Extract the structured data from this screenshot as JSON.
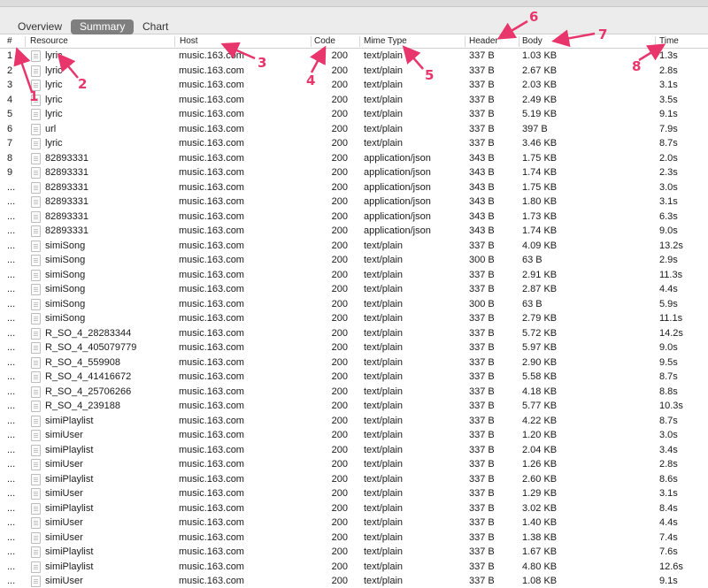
{
  "tabs": {
    "overview": "Overview",
    "summary": "Summary",
    "chart": "Chart"
  },
  "columns": {
    "idx": "#",
    "resource": "Resource",
    "host": "Host",
    "code": "Code",
    "mime": "Mime Type",
    "header": "Header",
    "body": "Body",
    "time": "Time"
  },
  "rows": [
    {
      "i": "1",
      "r": "lyric",
      "h": "music.163.com",
      "c": "200",
      "m": "text/plain",
      "hd": "337 B",
      "b": "1.03 KB",
      "t": "1.3s"
    },
    {
      "i": "2",
      "r": "lyric",
      "h": "music.163.com",
      "c": "200",
      "m": "text/plain",
      "hd": "337 B",
      "b": "2.67 KB",
      "t": "2.8s"
    },
    {
      "i": "3",
      "r": "lyric",
      "h": "music.163.com",
      "c": "200",
      "m": "text/plain",
      "hd": "337 B",
      "b": "2.03 KB",
      "t": "3.1s"
    },
    {
      "i": "4",
      "r": "lyric",
      "h": "music.163.com",
      "c": "200",
      "m": "text/plain",
      "hd": "337 B",
      "b": "2.49 KB",
      "t": "3.5s"
    },
    {
      "i": "5",
      "r": "lyric",
      "h": "music.163.com",
      "c": "200",
      "m": "text/plain",
      "hd": "337 B",
      "b": "5.19 KB",
      "t": "9.1s"
    },
    {
      "i": "6",
      "r": "url",
      "h": "music.163.com",
      "c": "200",
      "m": "text/plain",
      "hd": "337 B",
      "b": "397 B",
      "t": "7.9s"
    },
    {
      "i": "7",
      "r": "lyric",
      "h": "music.163.com",
      "c": "200",
      "m": "text/plain",
      "hd": "337 B",
      "b": "3.46 KB",
      "t": "8.7s"
    },
    {
      "i": "8",
      "r": "82893331",
      "h": "music.163.com",
      "c": "200",
      "m": "application/json",
      "hd": "343 B",
      "b": "1.75 KB",
      "t": "2.0s"
    },
    {
      "i": "9",
      "r": "82893331",
      "h": "music.163.com",
      "c": "200",
      "m": "application/json",
      "hd": "343 B",
      "b": "1.74 KB",
      "t": "2.3s"
    },
    {
      "i": "...",
      "r": "82893331",
      "h": "music.163.com",
      "c": "200",
      "m": "application/json",
      "hd": "343 B",
      "b": "1.75 KB",
      "t": "3.0s"
    },
    {
      "i": "...",
      "r": "82893331",
      "h": "music.163.com",
      "c": "200",
      "m": "application/json",
      "hd": "343 B",
      "b": "1.80 KB",
      "t": "3.1s"
    },
    {
      "i": "...",
      "r": "82893331",
      "h": "music.163.com",
      "c": "200",
      "m": "application/json",
      "hd": "343 B",
      "b": "1.73 KB",
      "t": "6.3s"
    },
    {
      "i": "...",
      "r": "82893331",
      "h": "music.163.com",
      "c": "200",
      "m": "application/json",
      "hd": "343 B",
      "b": "1.74 KB",
      "t": "9.0s"
    },
    {
      "i": "...",
      "r": "simiSong",
      "h": "music.163.com",
      "c": "200",
      "m": "text/plain",
      "hd": "337 B",
      "b": "4.09 KB",
      "t": "13.2s"
    },
    {
      "i": "...",
      "r": "simiSong",
      "h": "music.163.com",
      "c": "200",
      "m": "text/plain",
      "hd": "300 B",
      "b": "63 B",
      "t": "2.9s"
    },
    {
      "i": "...",
      "r": "simiSong",
      "h": "music.163.com",
      "c": "200",
      "m": "text/plain",
      "hd": "337 B",
      "b": "2.91 KB",
      "t": "11.3s"
    },
    {
      "i": "...",
      "r": "simiSong",
      "h": "music.163.com",
      "c": "200",
      "m": "text/plain",
      "hd": "337 B",
      "b": "2.87 KB",
      "t": "4.4s"
    },
    {
      "i": "...",
      "r": "simiSong",
      "h": "music.163.com",
      "c": "200",
      "m": "text/plain",
      "hd": "300 B",
      "b": "63 B",
      "t": "5.9s"
    },
    {
      "i": "...",
      "r": "simiSong",
      "h": "music.163.com",
      "c": "200",
      "m": "text/plain",
      "hd": "337 B",
      "b": "2.79 KB",
      "t": "11.1s"
    },
    {
      "i": "...",
      "r": "R_SO_4_28283344",
      "h": "music.163.com",
      "c": "200",
      "m": "text/plain",
      "hd": "337 B",
      "b": "5.72 KB",
      "t": "14.2s"
    },
    {
      "i": "...",
      "r": "R_SO_4_405079779",
      "h": "music.163.com",
      "c": "200",
      "m": "text/plain",
      "hd": "337 B",
      "b": "5.97 KB",
      "t": "9.0s"
    },
    {
      "i": "...",
      "r": "R_SO_4_559908",
      "h": "music.163.com",
      "c": "200",
      "m": "text/plain",
      "hd": "337 B",
      "b": "2.90 KB",
      "t": "9.5s"
    },
    {
      "i": "...",
      "r": "R_SO_4_41416672",
      "h": "music.163.com",
      "c": "200",
      "m": "text/plain",
      "hd": "337 B",
      "b": "5.58 KB",
      "t": "8.7s"
    },
    {
      "i": "...",
      "r": "R_SO_4_25706266",
      "h": "music.163.com",
      "c": "200",
      "m": "text/plain",
      "hd": "337 B",
      "b": "4.18 KB",
      "t": "8.8s"
    },
    {
      "i": "...",
      "r": "R_SO_4_239188",
      "h": "music.163.com",
      "c": "200",
      "m": "text/plain",
      "hd": "337 B",
      "b": "5.77 KB",
      "t": "10.3s"
    },
    {
      "i": "...",
      "r": "simiPlaylist",
      "h": "music.163.com",
      "c": "200",
      "m": "text/plain",
      "hd": "337 B",
      "b": "4.22 KB",
      "t": "8.7s"
    },
    {
      "i": "...",
      "r": "simiUser",
      "h": "music.163.com",
      "c": "200",
      "m": "text/plain",
      "hd": "337 B",
      "b": "1.20 KB",
      "t": "3.0s"
    },
    {
      "i": "...",
      "r": "simiPlaylist",
      "h": "music.163.com",
      "c": "200",
      "m": "text/plain",
      "hd": "337 B",
      "b": "2.04 KB",
      "t": "3.4s"
    },
    {
      "i": "...",
      "r": "simiUser",
      "h": "music.163.com",
      "c": "200",
      "m": "text/plain",
      "hd": "337 B",
      "b": "1.26 KB",
      "t": "2.8s"
    },
    {
      "i": "...",
      "r": "simiPlaylist",
      "h": "music.163.com",
      "c": "200",
      "m": "text/plain",
      "hd": "337 B",
      "b": "2.60 KB",
      "t": "8.6s"
    },
    {
      "i": "...",
      "r": "simiUser",
      "h": "music.163.com",
      "c": "200",
      "m": "text/plain",
      "hd": "337 B",
      "b": "1.29 KB",
      "t": "3.1s"
    },
    {
      "i": "...",
      "r": "simiPlaylist",
      "h": "music.163.com",
      "c": "200",
      "m": "text/plain",
      "hd": "337 B",
      "b": "3.02 KB",
      "t": "8.4s"
    },
    {
      "i": "...",
      "r": "simiUser",
      "h": "music.163.com",
      "c": "200",
      "m": "text/plain",
      "hd": "337 B",
      "b": "1.40 KB",
      "t": "4.4s"
    },
    {
      "i": "...",
      "r": "simiUser",
      "h": "music.163.com",
      "c": "200",
      "m": "text/plain",
      "hd": "337 B",
      "b": "1.38 KB",
      "t": "7.4s"
    },
    {
      "i": "...",
      "r": "simiPlaylist",
      "h": "music.163.com",
      "c": "200",
      "m": "text/plain",
      "hd": "337 B",
      "b": "1.67 KB",
      "t": "7.6s"
    },
    {
      "i": "...",
      "r": "simiPlaylist",
      "h": "music.163.com",
      "c": "200",
      "m": "text/plain",
      "hd": "337 B",
      "b": "4.80 KB",
      "t": "12.6s"
    },
    {
      "i": "...",
      "r": "simiUser",
      "h": "music.163.com",
      "c": "200",
      "m": "text/plain",
      "hd": "337 B",
      "b": "1.08 KB",
      "t": "9.1s"
    }
  ],
  "annotations": {
    "a1": "1",
    "a2": "2",
    "a3": "3",
    "a4": "4",
    "a5": "5",
    "a6": "6",
    "a7": "7",
    "a8": "8"
  },
  "colors": {
    "annotation": "#e8356b",
    "active_tab": "#7f7f7f"
  },
  "icons": {
    "file": "file-icon"
  }
}
